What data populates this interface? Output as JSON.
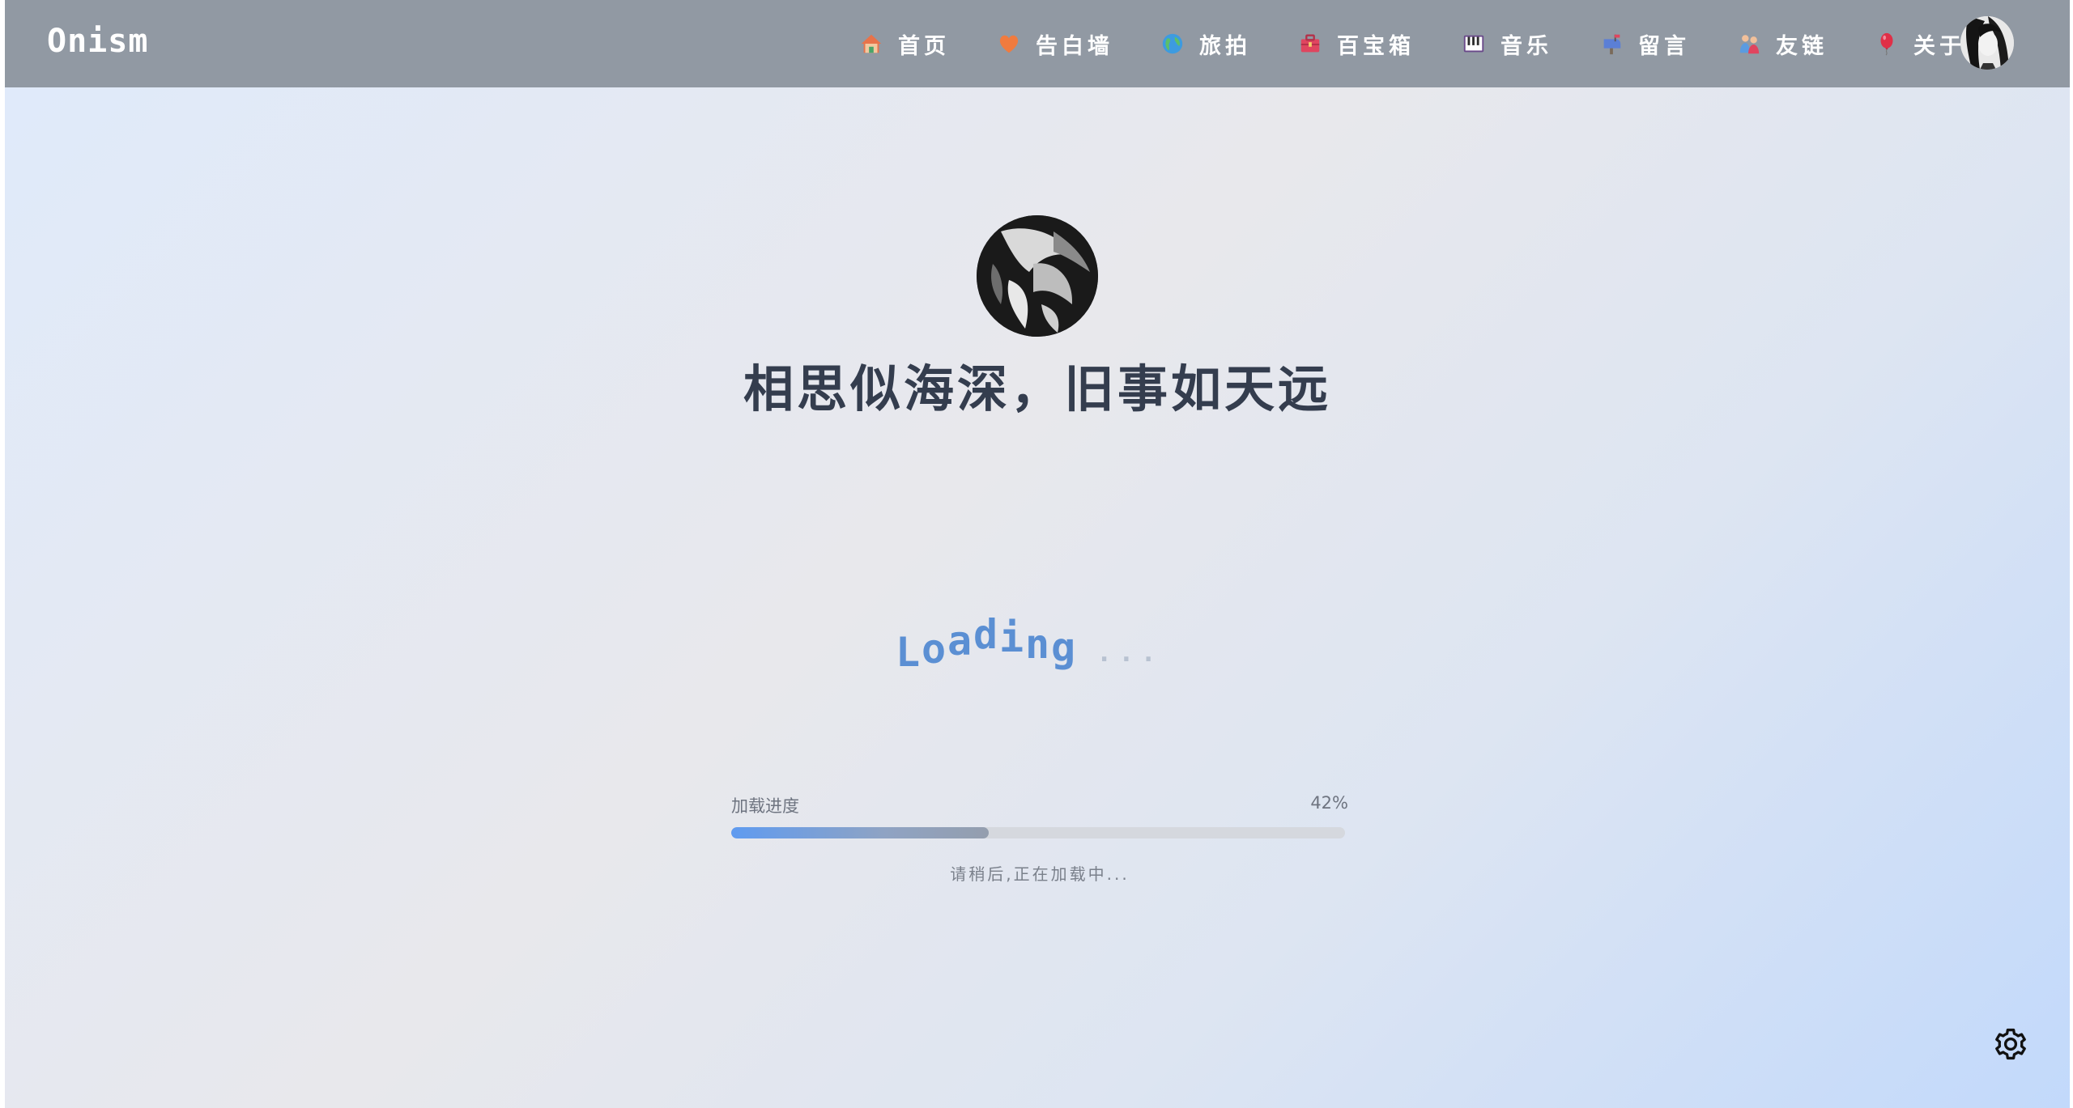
{
  "header": {
    "brand": "Onism",
    "nav": [
      {
        "label": "首页",
        "icon": "house-icon"
      },
      {
        "label": "告白墙",
        "icon": "heart-icon"
      },
      {
        "label": "旅拍",
        "icon": "globe-icon"
      },
      {
        "label": "百宝箱",
        "icon": "toolbox-icon"
      },
      {
        "label": "音乐",
        "icon": "piano-icon"
      },
      {
        "label": "留言",
        "icon": "mailbox-icon"
      },
      {
        "label": "友链",
        "icon": "people-icon"
      },
      {
        "label": "关于",
        "icon": "balloon-icon"
      }
    ]
  },
  "hero": {
    "title": "相思似海深，旧事如天远"
  },
  "loading": {
    "text": "Loading",
    "dots": "..."
  },
  "progress": {
    "label": "加载进度",
    "percent_text": "42%",
    "value": 0.42,
    "message": "请稍后,正在加载中..."
  },
  "colors": {
    "topbar": "#9199a3",
    "accent": "#5b8fd3",
    "title": "#343d4e"
  }
}
